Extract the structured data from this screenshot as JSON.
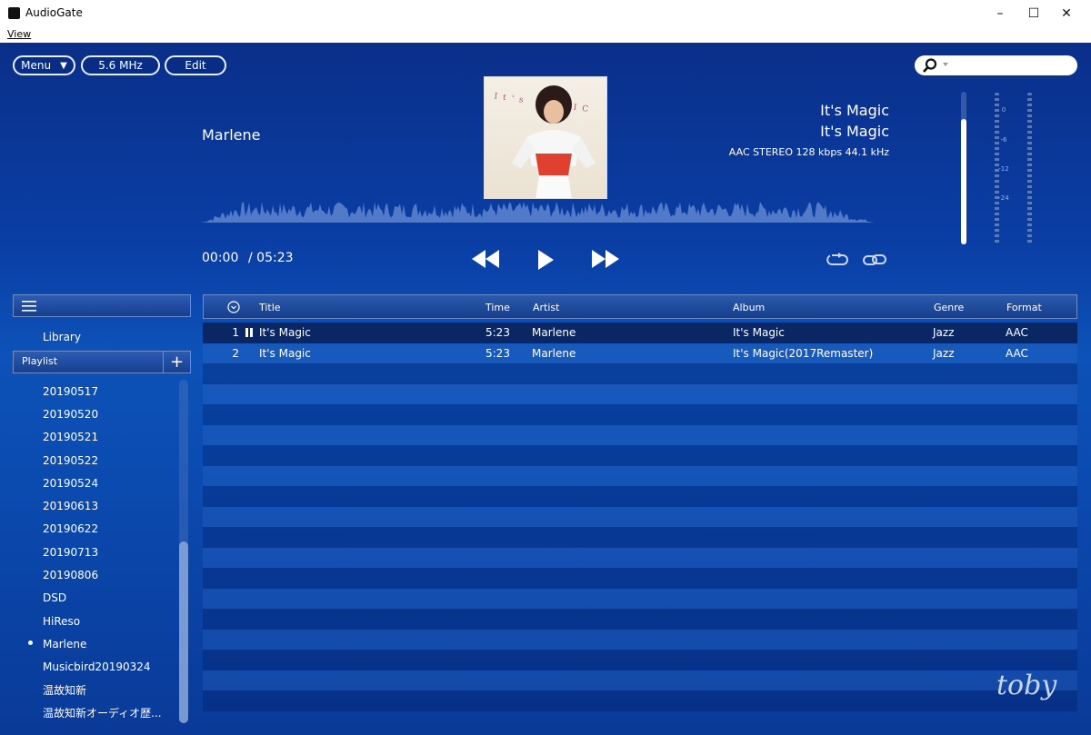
{
  "window": {
    "title": "AudioGate"
  },
  "menubar": {
    "view": "View"
  },
  "toolbar": {
    "menu": "Menu",
    "rate": "5.6 MHz",
    "edit": "Edit"
  },
  "search": {
    "placeholder": ""
  },
  "now_playing": {
    "artist": "Marlene",
    "title": "It's Magic",
    "album": "It's Magic",
    "format": "AAC STEREO 128 kbps 44.1 kHz",
    "time_current": "00:00",
    "time_total": "/ 05:23",
    "volume_level": 0.82
  },
  "meter_labels": [
    "0",
    "-6",
    "-12",
    "-24"
  ],
  "cover_text": "It's MAGIC",
  "sidebar": {
    "library": "Library",
    "playlist_header": "Playlist",
    "playlists": [
      {
        "name": "20190517",
        "active": false
      },
      {
        "name": "20190520",
        "active": false
      },
      {
        "name": "20190521",
        "active": false
      },
      {
        "name": "20190522",
        "active": false
      },
      {
        "name": "20190524",
        "active": false
      },
      {
        "name": "20190613",
        "active": false
      },
      {
        "name": "20190622",
        "active": false
      },
      {
        "name": "20190713",
        "active": false
      },
      {
        "name": "20190806",
        "active": false
      },
      {
        "name": "DSD",
        "active": false
      },
      {
        "name": "HiReso",
        "active": false
      },
      {
        "name": "Marlene",
        "active": true
      },
      {
        "name": "Musicbird20190324",
        "active": false
      },
      {
        "name": "温故知新",
        "active": false
      },
      {
        "name": "温故知新オーディオ歴...",
        "active": false
      }
    ]
  },
  "table": {
    "columns": {
      "title": "Title",
      "time": "Time",
      "artist": "Artist",
      "album": "Album",
      "genre": "Genre",
      "format": "Format"
    },
    "rows": [
      {
        "num": "1",
        "title": "It's Magic",
        "time": "5:23",
        "artist": "Marlene",
        "album": "It's Magic",
        "genre": "Jazz",
        "format": "AAC",
        "playing": true
      },
      {
        "num": "2",
        "title": "It's Magic",
        "time": "5:23",
        "artist": "Marlene",
        "album": "It's Magic(2017Remaster)",
        "genre": "Jazz",
        "format": "AAC",
        "playing": false
      }
    ]
  },
  "watermark": "toby",
  "colors": {
    "background": "#0b4cb2",
    "accent": "#ffffff"
  }
}
